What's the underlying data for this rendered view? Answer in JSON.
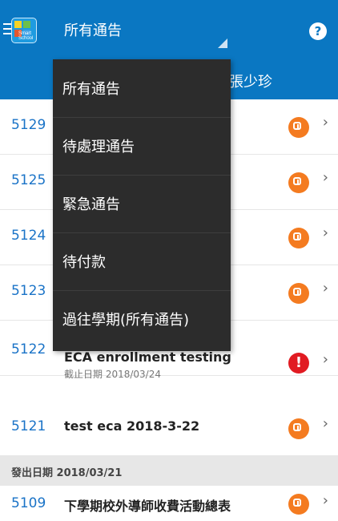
{
  "header": {
    "dropdown_title": "所有通告",
    "user_name": "張少珍",
    "logo_caption": "Smart School",
    "help_icon": "question-mark-icon"
  },
  "menu": {
    "items": [
      {
        "label": "所有通告"
      },
      {
        "label": "待處理通告"
      },
      {
        "label": "緊急通告"
      },
      {
        "label": "待付款"
      },
      {
        "label": "過往學期(所有通告)"
      }
    ]
  },
  "list": {
    "rows": [
      {
        "num": "5129",
        "title": "",
        "sub": "",
        "status": "pending"
      },
      {
        "num": "5125",
        "title": "",
        "sub": "",
        "status": "pending"
      },
      {
        "num": "5124",
        "title": "",
        "sub": "",
        "status": "pending"
      },
      {
        "num": "5123",
        "title": "",
        "sub": "",
        "status": "pending"
      },
      {
        "num": "5122",
        "title": "ECA enrollment testing",
        "sub": "截止日期 2018/03/24",
        "status": "urgent"
      },
      {
        "num": "5121",
        "title": "test eca 2018-3-22",
        "sub": "",
        "status": "pending"
      }
    ],
    "section_label": "發出日期 2018/03/21",
    "last_row": {
      "num": "5109",
      "title": "下學期校外導師收費活動總表",
      "status": "pending"
    }
  },
  "colors": {
    "primary": "#0a77c2",
    "pending": "#f47b20",
    "urgent": "#e11b22",
    "menu_bg": "#2c2c2c"
  }
}
